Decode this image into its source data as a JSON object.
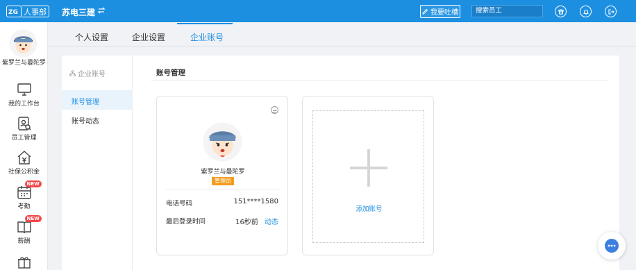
{
  "topbar": {
    "logo_text": "人事部",
    "company": "苏电三建",
    "feedback_label": "我要吐槽",
    "search_placeholder": "搜索员工"
  },
  "sidebar": {
    "user_name": "紫罗兰与曼陀罗",
    "items": [
      {
        "label": "我的工作台",
        "icon": "monitor-icon"
      },
      {
        "label": "员工管理",
        "icon": "employee-icon"
      },
      {
        "label": "社保公积金",
        "icon": "house-yen-icon"
      },
      {
        "label": "考勤",
        "icon": "calendar-icon",
        "badge": "NEW"
      },
      {
        "label": "薪酬",
        "icon": "book-icon",
        "badge": "NEW"
      }
    ]
  },
  "tabs": [
    {
      "label": "个人设置"
    },
    {
      "label": "企业设置"
    },
    {
      "label": "企业账号",
      "active": true
    }
  ],
  "subnav": {
    "title": "企业账号",
    "items": [
      {
        "label": "账号管理",
        "active": true
      },
      {
        "label": "账号动态"
      }
    ]
  },
  "section": {
    "title": "账号管理"
  },
  "account_card": {
    "name": "紫罗兰与曼陀罗",
    "role_badge": "管理员",
    "phone_label": "电话号码",
    "phone_value": "151****1580",
    "last_login_label": "最后登录时间",
    "last_login_value": "16秒前",
    "activity_link": "动态"
  },
  "add_card": {
    "label": "添加账号"
  },
  "colors": {
    "primary": "#1d8fe1",
    "badge_new": "#f5474a",
    "admin_badge": "#f39c1f"
  }
}
